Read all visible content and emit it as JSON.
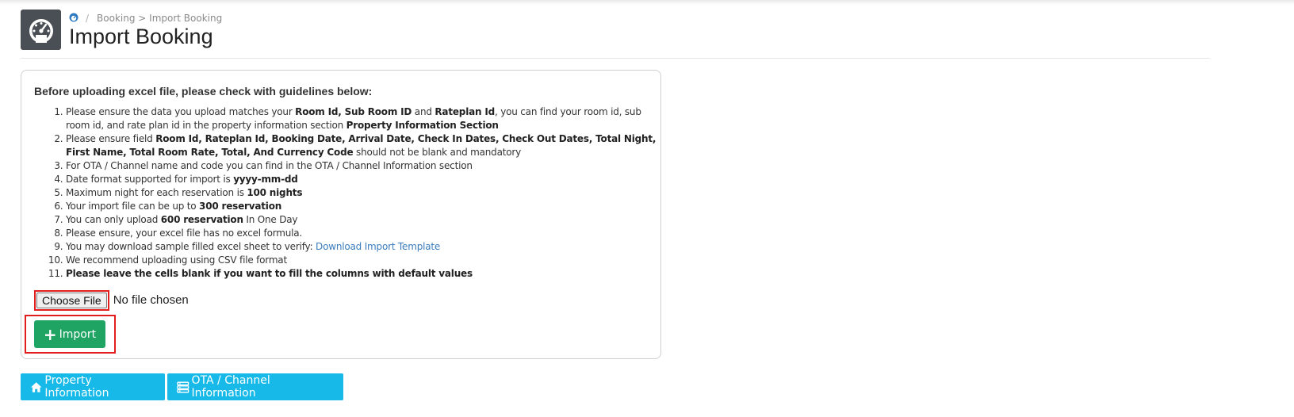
{
  "breadcrumb": {
    "home_icon": "dashboard-icon",
    "path": "Booking > Import Booking"
  },
  "page": {
    "title": "Import Booking",
    "logo_icon": "speedometer-icon"
  },
  "guidelines": {
    "heading": "Before uploading excel file, please check with guidelines below:",
    "items": {
      "1": {
        "a": "Please ensure the data you upload matches your ",
        "b1": "Room Id, Sub Room ID",
        "c": " and ",
        "b2": "Rateplan Id",
        "d": ", you can find your room id, sub room id, and rate plan id in the property information section ",
        "b3": "Property Information Section"
      },
      "2": {
        "a": "Please ensure field ",
        "b1": "Room Id, Rateplan Id, Booking Date, Arrival Date, Check In Dates, Check Out Dates, Total Night, First Name, Total Room Rate, Total, And Currency Code",
        "c": " should not be blank and mandatory"
      },
      "3": {
        "a": "For OTA / Channel name and code you can find in the OTA / Channel Information section"
      },
      "4": {
        "a": "Date format supported for import is ",
        "b1": "yyyy-mm-dd"
      },
      "5": {
        "a": "Maximum night for each reservation is ",
        "b1": "100 nights"
      },
      "6": {
        "a": "Your import file can be up to ",
        "b1": "300 reservation"
      },
      "7": {
        "a": "You can only upload ",
        "b1": "600 reservation",
        "c": " In One Day"
      },
      "8": {
        "a": "Please ensure, your excel file has no excel formula."
      },
      "9": {
        "a": "You may download sample filled excel sheet to verify: ",
        "link": "Download Import Template"
      },
      "10": {
        "a": "We recommend uploading using CSV file format"
      },
      "11": {
        "b1": "Please leave the cells blank if you want to fill the columns with default values"
      }
    }
  },
  "file_input": {
    "button_label": "Choose File",
    "status": "No file chosen"
  },
  "import_button": {
    "icon": "plus-icon",
    "label": "Import"
  },
  "bottom_buttons": {
    "property": {
      "icon": "home-icon",
      "label": "Property Information"
    },
    "ota": {
      "icon": "server-icon",
      "label": "OTA / Channel Information"
    }
  },
  "colors": {
    "logo_bg": "#4a4f55",
    "import_green": "#1fa463",
    "info_blue": "#17b9e8",
    "highlight_red": "#e11d1d",
    "link_blue": "#3b7dbd"
  }
}
